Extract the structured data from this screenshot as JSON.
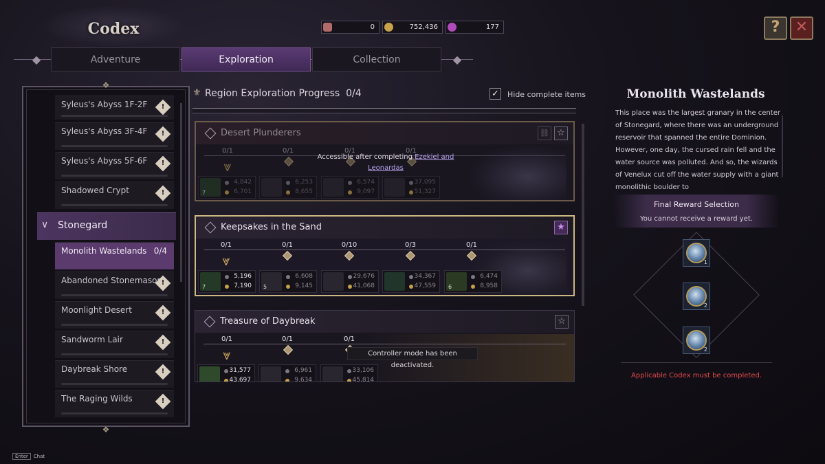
{
  "header": {
    "title": "Codex",
    "currencies": [
      {
        "icon": "quill-icon",
        "value": "0",
        "color": "#b26a6a"
      },
      {
        "icon": "gold-coin-icon",
        "value": "752,436",
        "color": "#c7a24a"
      },
      {
        "icon": "gem-icon",
        "value": "177",
        "color": "#b04cba"
      }
    ],
    "help_icon": "scroll-help-icon",
    "close_icon": "close-icon"
  },
  "tabs": [
    {
      "label": "Adventure",
      "active": false
    },
    {
      "label": "Exploration",
      "active": true
    },
    {
      "label": "Collection",
      "active": false
    }
  ],
  "sidebar": {
    "items_top": [
      {
        "label": "Syleus's Abyss 1F-2F"
      },
      {
        "label": "Syleus's Abyss 3F-4F"
      },
      {
        "label": "Syleus's Abyss 5F-6F"
      },
      {
        "label": "Shadowed Crypt"
      }
    ],
    "group": {
      "label": "Stonegard"
    },
    "selected": {
      "label": "Monolith Wastelands",
      "count": "0/4"
    },
    "items_bottom": [
      {
        "label": "Abandoned Stonemason"
      },
      {
        "label": "Moonlight Desert"
      },
      {
        "label": "Sandworm Lair"
      },
      {
        "label": "Daybreak Shore"
      },
      {
        "label": "The Raging Wilds"
      }
    ],
    "alert_glyph": "!"
  },
  "main": {
    "title": "Region Exploration Progress",
    "progress": "0/4",
    "hide_complete": {
      "label": "Hide complete items",
      "checked": true,
      "mark": "✓"
    },
    "cards": [
      {
        "name": "Desert Plunderers",
        "locked": true,
        "lock_msg_prefix": "Accessible after completing",
        "lock_msg_link": "Ezekiel and Leonardas",
        "counts": [
          "0/1",
          "0/1",
          "0/1",
          "0/1"
        ],
        "rewards": [
          {
            "qty": "7",
            "v1": "4,842",
            "v2": "6,701"
          },
          {
            "qty": "",
            "v1": "6,253",
            "v2": "8,655"
          },
          {
            "qty": "",
            "v1": "6,574",
            "v2": "9,097"
          },
          {
            "qty": "",
            "v1": "37,095",
            "v2": "51,327"
          }
        ]
      },
      {
        "name": "Keepsakes in the Sand",
        "locked": false,
        "counts": [
          "0/1",
          "0/1",
          "0/10",
          "0/3",
          "0/1"
        ],
        "rewards": [
          {
            "qty": "7",
            "v1": "5,196",
            "v2": "7,190"
          },
          {
            "qty": "5",
            "v1": "6,608",
            "v2": "9,145"
          },
          {
            "qty": "",
            "v1": "29,676",
            "v2": "41,068"
          },
          {
            "qty": "",
            "v1": "34,367",
            "v2": "47,559"
          },
          {
            "qty": "6",
            "v1": "6,474",
            "v2": "8,958"
          }
        ]
      },
      {
        "name": "Treasure of Daybreak",
        "locked": false,
        "counts": [
          "0/1",
          "0/1",
          "0/1"
        ],
        "rewards": [
          {
            "qty": "",
            "v1": "31,577",
            "v2": "43,697"
          },
          {
            "qty": "",
            "v1": "6,961",
            "v2": "9,634"
          },
          {
            "qty": "",
            "v1": "33,106",
            "v2": "45,814"
          }
        ]
      }
    ],
    "toast": "Controller mode has been deactivated."
  },
  "detail": {
    "title": "Monolith Wastelands",
    "description": "This place was the largest granary in the center of Stonegard, where there was an underground reservoir that spanned the entire Dominion. However, one day, the cursed rain fell and the water source was polluted. And so, the wizards of Venelux cut off the water supply with a giant monolithic boulder to",
    "reward_title": "Final Reward Selection",
    "reward_subtitle": "You cannot receive a reward yet.",
    "rewards": [
      {
        "icon": "tools-icon",
        "qty": "1"
      },
      {
        "icon": "armor-icon",
        "qty": "2"
      },
      {
        "icon": "ring-icon",
        "qty": "2"
      }
    ],
    "warning": "Applicable Codex must be completed."
  },
  "footer": {
    "key": "Enter",
    "label": "Chat"
  }
}
